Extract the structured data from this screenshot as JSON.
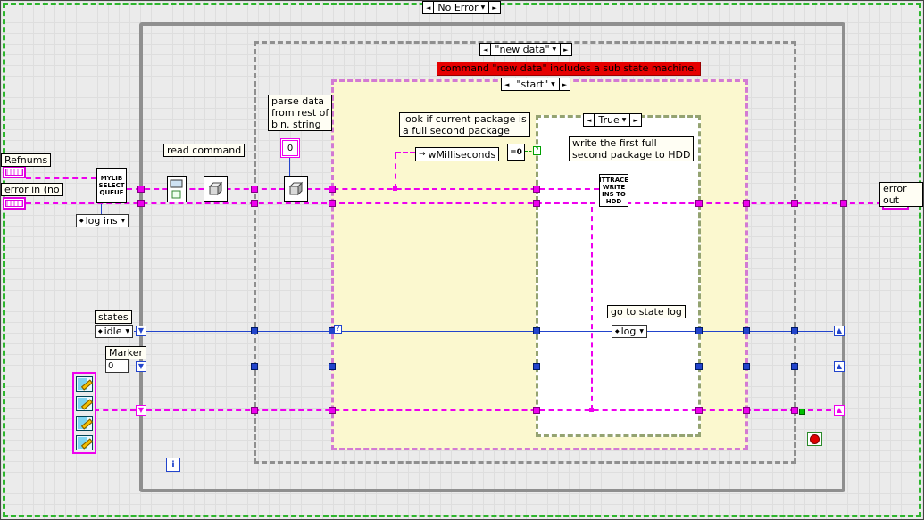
{
  "colors": {
    "cluster_wire": "#ee00ee",
    "numeric_wire": "#2244cc",
    "boolean_wire": "#00a000",
    "case_start_bg": "#fbf8cf",
    "banner_bg": "#e60000",
    "while_loop_border": "#8f8f8f",
    "error_case_border": "#2db52d"
  },
  "icons": {
    "arrow_left": "◄",
    "arrow_right": "►",
    "arrow_down": "▼",
    "shift_reg_down": "▼",
    "shift_reg_up": "▲",
    "enum_glyph": "◆",
    "local_var_arrow": "→",
    "unwired_question": "?"
  },
  "case_selectors": {
    "no_error": "No Error",
    "new_data": "\"new data\"",
    "start": "\"start\"",
    "true_case": "True"
  },
  "banner": {
    "text": "command \"new data\" includes a sub state machine."
  },
  "labels": {
    "refnums": "Refnums",
    "error_in": "error in (no",
    "error_out": "error out",
    "read_command": "read command",
    "parse_data": "parse data\nfrom rest of\nbin. string",
    "look_if": "look if current package is\na full second package",
    "write_first": "write the first full\nsecond package to HDD",
    "go_to_state": "go to state log",
    "states": "states",
    "marker": "Marker"
  },
  "nodes": {
    "mylib_select_queue": "MYLIB\nSELECT\nQUEUE",
    "ittrace_write": "ITTRACE\nWRITE\nINS TO\nHDD",
    "wmilliseconds": "wMilliseconds",
    "equal_zero": "=0",
    "iteration": "i"
  },
  "constants": {
    "string_zero": "0",
    "marker_value": "0",
    "log_ins": "log ins",
    "idle": "idle",
    "log": "log"
  }
}
